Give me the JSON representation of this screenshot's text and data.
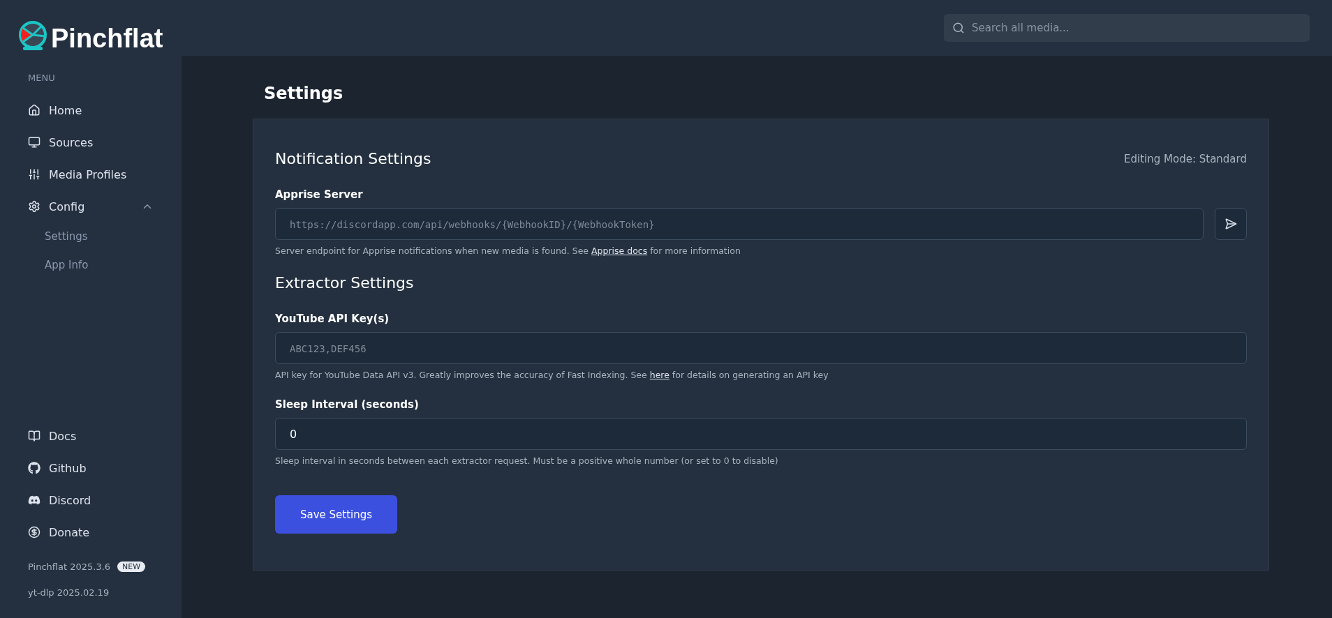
{
  "header": {
    "logo_text": "Pinchflat",
    "search": {
      "placeholder": "Search all media..."
    }
  },
  "sidebar": {
    "menu_label": "MENU",
    "items": [
      {
        "label": "Home"
      },
      {
        "label": "Sources"
      },
      {
        "label": "Media Profiles"
      },
      {
        "label": "Config",
        "expanded": true,
        "children": [
          {
            "label": "Settings"
          },
          {
            "label": "App Info"
          }
        ]
      }
    ],
    "footer_links": [
      {
        "label": "Docs"
      },
      {
        "label": "Github"
      },
      {
        "label": "Discord"
      },
      {
        "label": "Donate"
      }
    ],
    "versions": [
      {
        "text": "Pinchflat 2025.3.6",
        "badge": "NEW"
      },
      {
        "text": "yt-dlp 2025.02.19"
      }
    ]
  },
  "page": {
    "title": "Settings",
    "sections": [
      {
        "title": "Notification Settings",
        "mode": "Editing Mode: Standard",
        "fields": [
          {
            "kind": "test",
            "label": "Apprise Server",
            "placeholder": "https://discordapp.com/api/webhooks/{WebhookID}/{WebhookToken}",
            "help_before": "Server endpoint for Apprise notifications when new media is found. See ",
            "help_link": "Apprise docs",
            "help_after": " for more information"
          }
        ]
      },
      {
        "title": "Extractor Settings",
        "fields": [
          {
            "kind": "plain",
            "label": "YouTube API Key(s)",
            "placeholder": "ABC123,DEF456",
            "help_before": "API key for YouTube Data API v3. Greatly improves the accuracy of Fast Indexing. See ",
            "help_link": "here",
            "help_after": " for details on generating an API key"
          },
          {
            "kind": "plain",
            "label": "Sleep Interval (seconds)",
            "value": "0",
            "help_before": "Sleep interval in seconds between each extractor request. Must be a positive whole number (or set to 0 to disable)"
          }
        ]
      }
    ],
    "save_button": "Save Settings"
  }
}
